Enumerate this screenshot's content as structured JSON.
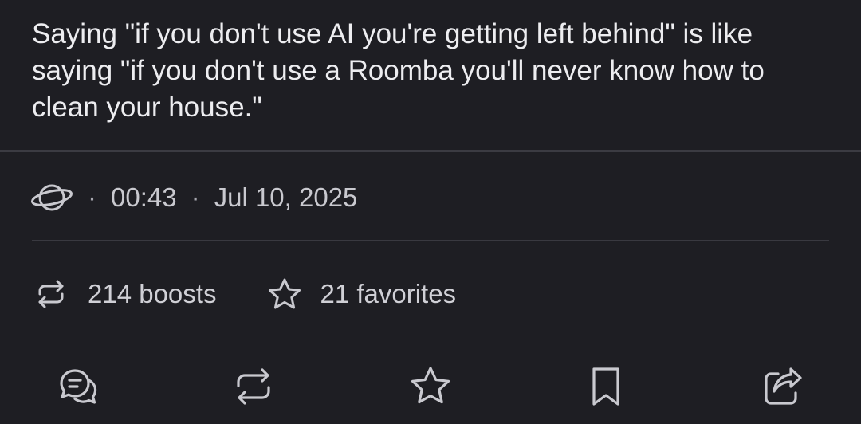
{
  "post": {
    "text": "Saying \"if you don't use AI you're getting left behind\" is like saying \"if you don't use a Roomba you'll never know how to clean your house.\""
  },
  "meta": {
    "visibility_icon": "globe-icon",
    "separator": "·",
    "time": "00:43",
    "date": "Jul 10, 2025"
  },
  "stats": {
    "boosts_icon": "boost-icon",
    "boosts_label": "214 boosts",
    "favorites_icon": "star-icon",
    "favorites_label": "21 favorites"
  },
  "actions": [
    {
      "icon": "reply-icon"
    },
    {
      "icon": "boost-icon"
    },
    {
      "icon": "star-icon"
    },
    {
      "icon": "bookmark-icon"
    },
    {
      "icon": "share-icon"
    }
  ],
  "colors": {
    "background": "#1e1e23",
    "text": "#ededf0",
    "muted": "#c9c9cf",
    "divider": "#3b3b42"
  }
}
